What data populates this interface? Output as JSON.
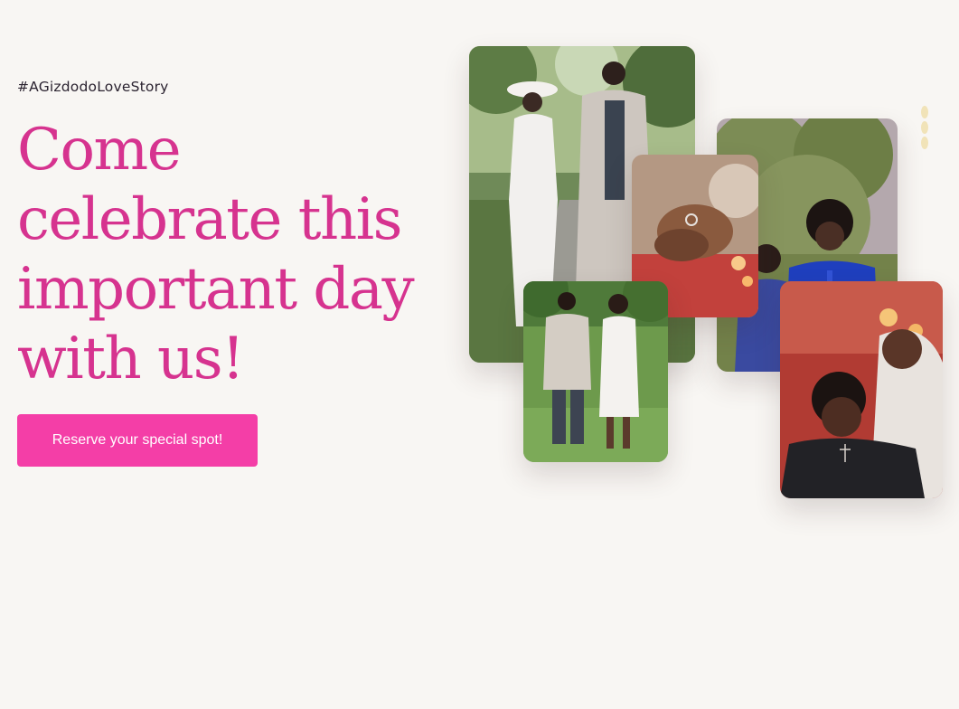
{
  "hero": {
    "hashtag": "#AGizdodoLoveStory",
    "headline": "Come celebrate this important day with us!",
    "cta_label": "Reserve your special spot!"
  },
  "colors": {
    "background": "#f8f6f3",
    "accent": "#d6338f",
    "button": "#f43ea7",
    "hashtag_text": "#2b2330",
    "decoration": "#f1e3b8"
  },
  "gallery": [
    {
      "name": "couple-walking-path-photo"
    },
    {
      "name": "engagement-ring-hand-photo"
    },
    {
      "name": "couple-by-hedge-photo"
    },
    {
      "name": "couple-walking-grass-photo"
    },
    {
      "name": "couple-embrace-red-photo"
    }
  ],
  "decoration_icon": "diamond-chain-icon"
}
